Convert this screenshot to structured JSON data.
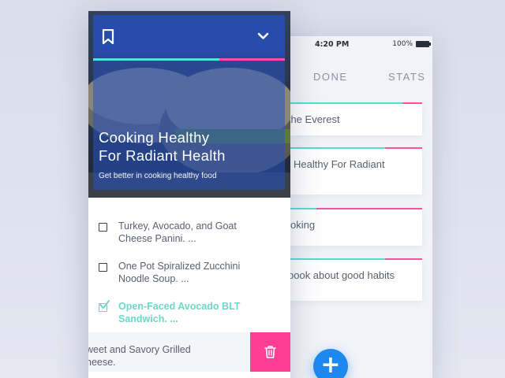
{
  "back_screen": {
    "status_bar": {
      "time": "4:20 PM",
      "battery": "100%"
    },
    "tabs": [
      {
        "label": "DONE"
      },
      {
        "label": "STATS"
      }
    ],
    "cards": [
      {
        "text": "p the Everest",
        "progress": 0.85
      },
      {
        "text": "Healthy For Radiant",
        "progress": 0.72
      },
      {
        "text": "oking",
        "progress": 0.2
      },
      {
        "text": "book about good habits",
        "progress": 0.72
      }
    ],
    "fab_label": "+"
  },
  "front_screen": {
    "hero": {
      "title_line1": "Cooking Healthy",
      "title_line2": "For Radiant Health",
      "subtitle": "Get better in cooking healthy food",
      "progress": 0.66,
      "icons": {
        "left": "bookmark-icon",
        "right": "chevron-down-icon"
      }
    },
    "tasks": [
      {
        "line1": "Turkey, Avocado, and Goat",
        "line2": "Cheese Panini. ...",
        "done": false
      },
      {
        "line1": "One Pot Spiralized Zucchini",
        "line2": "Noodle Soup. ...",
        "done": false
      },
      {
        "line1": "Open-Faced Avocado BLT",
        "line2": "Sandwich. ...",
        "done": true
      }
    ],
    "swiped_task": {
      "line1": "weet and Savory Grilled",
      "line2": "heese."
    },
    "delete_icon": "trash-icon"
  },
  "colors": {
    "accent_teal": "#51e1d6",
    "accent_pink": "#ff4fa3",
    "fab_blue": "#1e88f0",
    "hero_overlay": "#2654c4",
    "done_text": "#6fd6c8"
  }
}
